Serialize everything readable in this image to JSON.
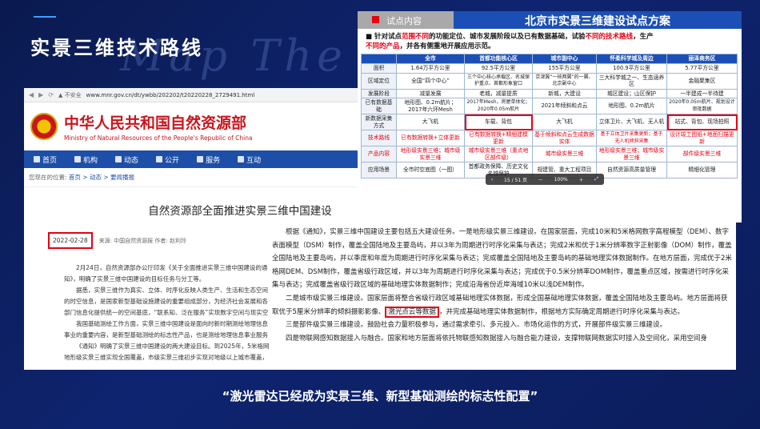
{
  "slide": {
    "title": "实景三维技术路线",
    "watermark": "Map The W",
    "quote": "“激光雷达已经成为实景三维、新型基础测绘的标志性配置”"
  },
  "browser": {
    "insecure": "▲ 不安全",
    "url": "www.mnr.gov.cn/dt/ywbb/202202/t20220228_2729491.html",
    "site_cn": "中华人民共和国自然资源部",
    "site_en": "Ministry of Natural Resources of the People's Republic of China",
    "nav": [
      "首页",
      "机构",
      "动态",
      "公开",
      "服务",
      "互动"
    ],
    "crumb_prefix": "您现在的位置:",
    "crumb_path": "首页 > 动态 > 要闻播报",
    "article_title": "自然资源部全面推进实景三维中国建设",
    "date": "2022-02-28",
    "source": "来源: 中国自然资源报    作者: 赵利玲",
    "paragraphs": [
      "2月24日，自然资源部办公厅印发《关于全面推进实景三维中国建设的通知》，明确了实景三维中国建设的目标任务与分工等。",
      "据悉，实景三维作为真实、立体、时序化反映人类生产、生活和生态空间的时空信息，是国家新型基础设施建设的重要组成部分，为经济社会发展和各部门信息化提供统一的空间基底，“联系知、泛在服务”实现数字空间与现实空间的实时关联互通，为数字中国提供了统一的时空基准。",
      "我国基础测绘工作方面，实景三维中国建设是面向时新时期测绘地理信息事业的重要内容，是新型基础测绘的标志性产品，也是测绘地理信息事业服务经济社会发展和生态文明建设的重要支撑。",
      "《通知》明确了实景三维中国建设的两大建设目标。到2025年，5米格网地形级实景三维实现全国覆盖，市级实景三维初步实现对地级以上城市覆盖，国家和省市县多级实景三维在线与离线相结合的服务系统初步建成。"
    ]
  },
  "article": {
    "paragraphs": [
      "根据《通知》，实景三维中国建设主要包括五大建设任务。一是地形级实景三维建设。在国家层面，完成10米和5米格网数字高程模型（DEM）、数字表面模型（DSM）制作，覆盖全国陆地及主要岛屿，并以3年为周期进行时序化采集与表达；完成2米和优于1米分辨率数字正射影像（DOM）制作，覆盖全国陆地及主要岛屿，并以季度和年度为周期进行时序化采集与表达；完成覆盖全国陆地及主要岛屿的基础地理实体数据制作。在地方层面，完成优于2米格网DEM、DSM制作，覆盖省级行政区域，并以3年为周期进行时序化采集与表达；完成优于0.5米分辨率DOM制作，覆盖重点区域，按需进行时序化采集与表达；完成覆盖省级行政区域的基础地理实体数据制作；完成沿海省份近岸海域10米以浅DEM制作。",
      "二是城市级实景三维建设。国家层面将整合省级行政区域基础地理实体数据，形成全国基础地理实体数据，覆盖全国陆地及主要岛屿。地方层面将获取优于5厘米分辨率的倾斜摄影影像、",
      "三是部件级实景三维建设。鼓励社会力量积极参与，通过需求牵引、多元投入、市场化运作的方式，开展部件级实景三维建设。",
      "四是物联网感知数据接入与融合。国家和地方层面将依托物联感知数据接入与融合能力建设，支撑物联网数据实时接入及空间化，采用空间身"
    ],
    "highlight": "激光点云等数据",
    "after_highlight": "，并完成基础地理实体数据制作，根据地方实际确定周期进行时序化采集与表达。"
  },
  "panel": {
    "tab": "试点内容",
    "title": "北京市实景三维建设试点方案",
    "intro_a": "针对试点",
    "intro_r1": "范围不同",
    "intro_b": "的功能定位、城市发展阶段以及已有数据基础，试验",
    "intro_r2": "不同的技术路线",
    "intro_c": "，生产",
    "intro_r3": "不同的产品",
    "intro_d": "，并各有侧重地开展应用示范。",
    "columns": [
      "",
      "全市",
      "首都功能核心区",
      "城市副中心",
      "怀柔科学城及周边",
      "丽泽商务区"
    ],
    "rows": [
      {
        "label": "面积",
        "cells": [
          "1.64万平方公里",
          "92.5平方公里",
          "155平方公里",
          "100.9平方公里",
          "5.77平方公里"
        ]
      },
      {
        "label": "区域定位",
        "cells": [
          "全国“四个中心”",
          "三个中心核心承载区、名城保护重点、首都形象窗口",
          "京津冀“一核两翼”的一翼、北京副中心",
          "三大科学城之一、生态涵养区",
          "金融聚集区"
        ]
      },
      {
        "label": "发展阶段",
        "cells": [
          "减量发展",
          "老城，减量提质",
          "新城，大建设",
          "城区建设；山区保护",
          "一半建成一半待建"
        ]
      },
      {
        "label": "已有数据基础",
        "cells": [
          "地形图、0.2m航片；2017年六环Mesh",
          "2017年Mesh，房屋单体化；2020年0.05m航片",
          "2021年倾斜和点云",
          "地形图、0.2m航片",
          "2020年0.05m航片、规划设计审批数据"
        ]
      },
      {
        "label": "新数据采集方式",
        "cells": [
          "大飞机",
          "车载、背包",
          "大飞机",
          "立体卫片、大飞机、无人机",
          "站式、背包、现场拍照"
        ]
      },
      {
        "label": "技术路线",
        "cells": [
          "已有数据转换+立体更新",
          "已有数据转换+精细建模更新",
          "基于倾斜和点云生成数据实体",
          "基于立体卫片采集更新；基于无人机倾斜采集",
          "设计竣工图纸+地面扫描更新"
        ]
      },
      {
        "label": "产品内容",
        "cells": [
          "地形级实景三维；城市级实景三维",
          "城市级实景三维（重点地区部件级）",
          "城市级实景三维",
          "地形级实景三维；城市级实景三维",
          "部件级实景三维"
        ]
      },
      {
        "label": "应用场景",
        "cells": [
          "全市时空底图（一图）",
          "首都政务保障、历史文化名城保护",
          "规建管、重大工程项目",
          "自然资源高质量管理",
          "精细化管理"
        ]
      }
    ],
    "viewer": {
      "page": "15 / 51 页",
      "zoom": "100%"
    }
  }
}
